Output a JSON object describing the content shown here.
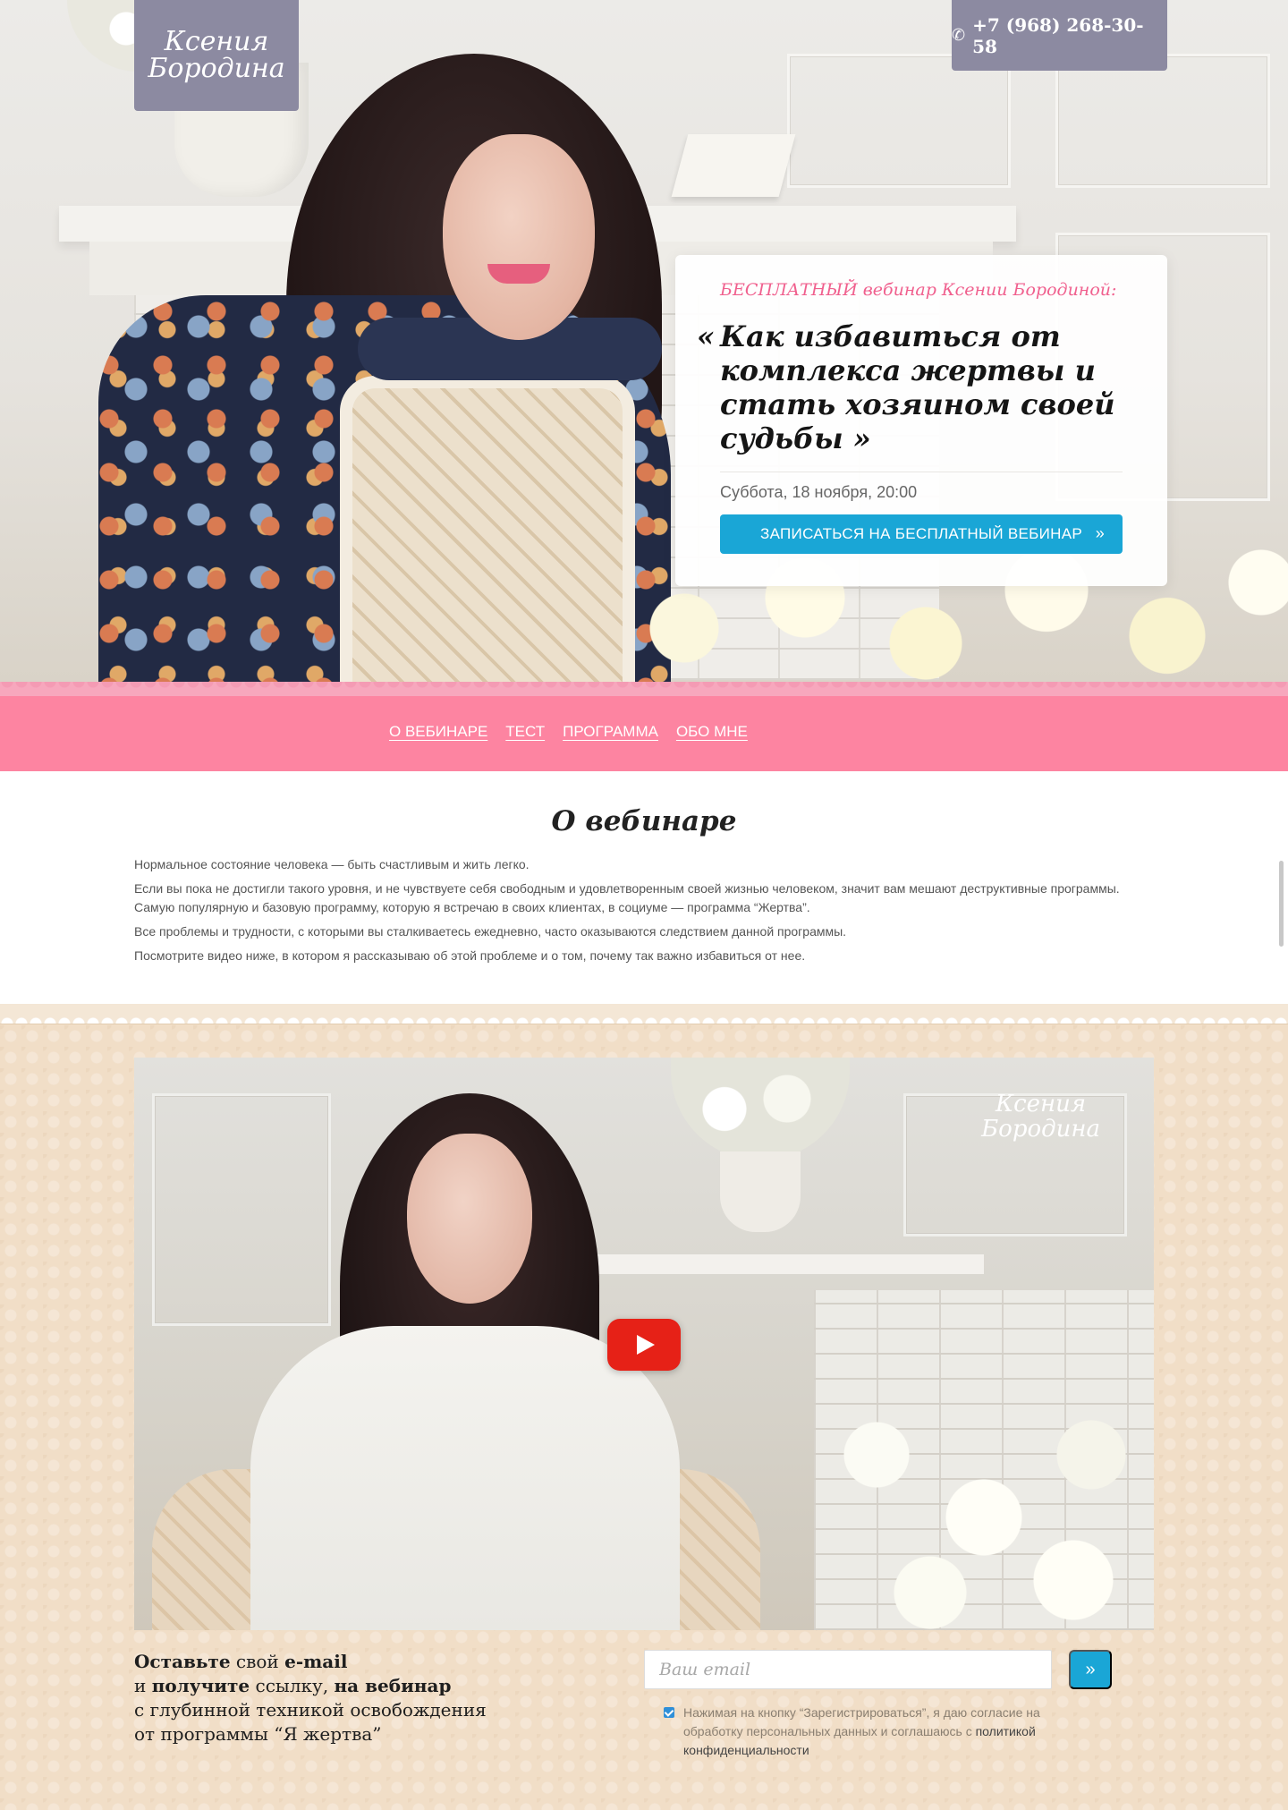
{
  "header": {
    "logo_text_line1": "Ксения",
    "logo_text_line2": "Бородина",
    "phone": "+7 (968) 268-30-58"
  },
  "hero_card": {
    "eyebrow": "БЕСПЛАТНЫЙ вебинар Ксении Бородиной:",
    "title_open_quote": "«",
    "title": "Как избавиться от комплекса жертвы и стать хозяином своей судьбы",
    "title_close_quote": "»",
    "date": "Суббота, 18 ноября, 20:00",
    "cta_label": "ЗАПИСАТЬСЯ НА БЕСПЛАТНЫЙ ВЕБИНАР",
    "cta_icon": "»"
  },
  "nav": {
    "items": [
      {
        "label": "О ВЕБИНАРЕ"
      },
      {
        "label": "ТЕСТ"
      },
      {
        "label": "ПРОГРАММА"
      },
      {
        "label": "ОБО МНЕ"
      }
    ]
  },
  "about": {
    "title": "О вебинаре",
    "paragraphs": [
      "Нормальное состояние человека — быть счастливым и жить легко.",
      "Если вы пока не достигли такого уровня, и не чувствуете себя свободным и удовлетворенным своей жизнью человеком, значит вам мешают деструктивные программы. Самую популярную и базовую программу, которую я встречаю в своих клиентах, в социуме — программа “Жертва”.",
      "Все проблемы и трудности, с которыми вы сталкиваетесь ежедневно, часто оказываются следствием данной программы.",
      "Посмотрите видео ниже, в котором я рассказываю об этой проблеме и о том, почему так важно избавиться от нее."
    ]
  },
  "video": {
    "logo_line1": "Ксения",
    "logo_line2": "Бородина"
  },
  "signup": {
    "line1_bold1": "Оставьте",
    "line1_normal": " свой ",
    "line1_bold2": "e-mail",
    "line2_normal1": "и ",
    "line2_bold1": "получите",
    "line2_normal2": " ссылку, ",
    "line2_bold2": "на вебинар",
    "line3": "с глубинной техникой освобождения",
    "line4": "от программы “Я жертва”",
    "email_placeholder": "Ваш email",
    "submit_icon": "»",
    "consent_text": "Нажимая на кнопку “Зарегистрироваться”, я даю согласие на обработку персональных данных и соглашаюсь с ",
    "consent_link": "политикой конфиденциальности"
  },
  "colors": {
    "nav_pink": "#fd84a1",
    "accent_pink": "#f0608e",
    "button_blue": "#1aa6d6",
    "logo_bg": "#8c8aa1",
    "section_beige": "#f1dec7"
  }
}
